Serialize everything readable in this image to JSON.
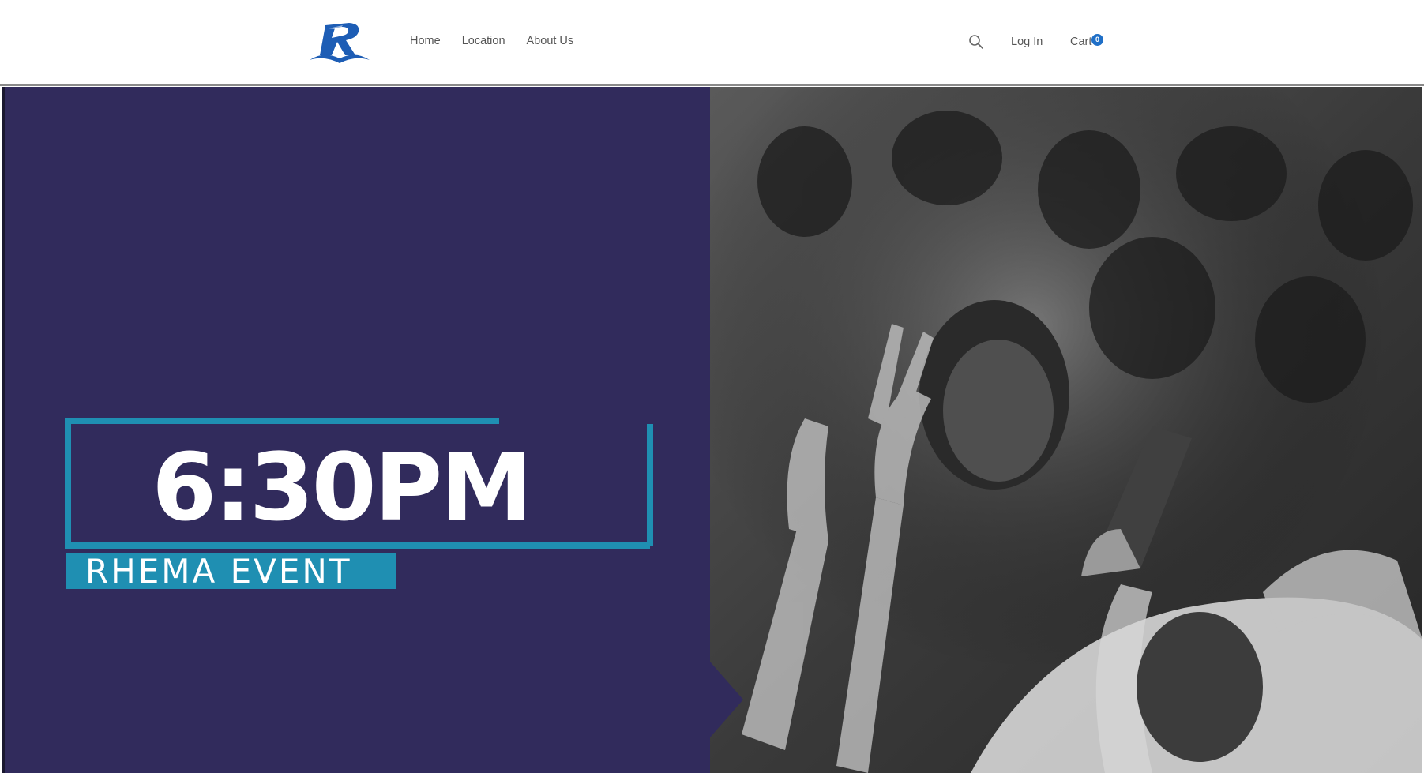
{
  "header": {
    "logo_letter": "R",
    "nav": [
      {
        "label": "Home"
      },
      {
        "label": "Location"
      },
      {
        "label": "About Us"
      }
    ],
    "login_label": "Log In",
    "cart_label": "Cart",
    "cart_count": "0",
    "search_icon": "search-icon"
  },
  "hero": {
    "time": "6:30PM",
    "event_label": "RHEMA EVENT",
    "image": "black-and-white photo of worship crowd with raised hands"
  },
  "colors": {
    "logo_blue": "#1d5db5",
    "hero_panel": "#312b5c",
    "accent_teal": "#1f8fb2",
    "cart_badge": "#1f6fc7"
  }
}
